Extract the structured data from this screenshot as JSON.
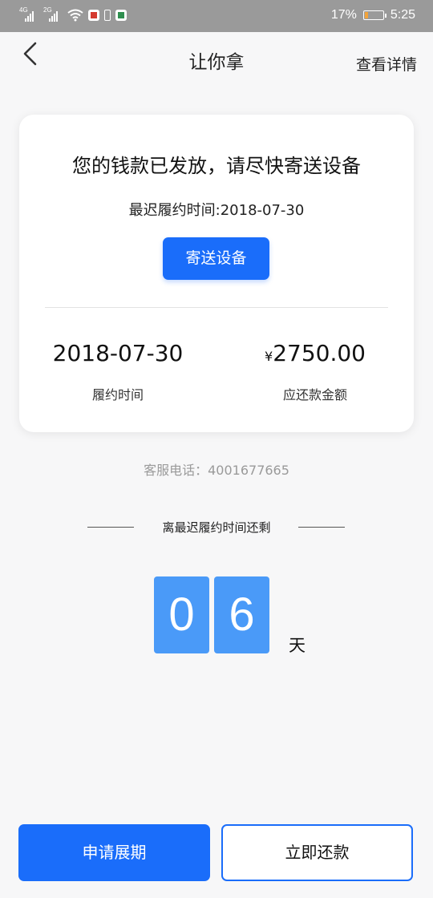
{
  "status_bar": {
    "signal1_tag": "4G",
    "signal2_tag": "2G",
    "battery_percent": "17%",
    "battery_level": 0.17,
    "time": "5:25",
    "icons": [
      "signal-4g-icon",
      "signal-2g-icon",
      "wifi-icon",
      "app-notification-icon",
      "battery-saver-icon",
      "app-notification-icon"
    ]
  },
  "header": {
    "title": "让你拿",
    "detail_link": "查看详情",
    "back_icon": "chevron-left-icon"
  },
  "card": {
    "message": "您的钱款已发放，请尽快寄送设备",
    "deadline_text": "最迟履约时间:2018-07-30",
    "send_button": "寄送设备",
    "left": {
      "value": "2018-07-30",
      "label": "履约时间"
    },
    "right": {
      "currency": "¥",
      "value": "2750.00",
      "label": "应还款金额"
    }
  },
  "service": {
    "label": "客服电话：",
    "phone": "4001677665"
  },
  "countdown": {
    "label": "离最迟履约时间还剩",
    "digits": [
      "0",
      "6"
    ],
    "unit": "天"
  },
  "buttons": {
    "extend": "申请展期",
    "repay": "立即还款"
  },
  "colors": {
    "primary": "#1a6dfa",
    "digit_bg": "#4a9af8",
    "status_bar": "#9a9a9a",
    "battery": "#f2a33a"
  }
}
